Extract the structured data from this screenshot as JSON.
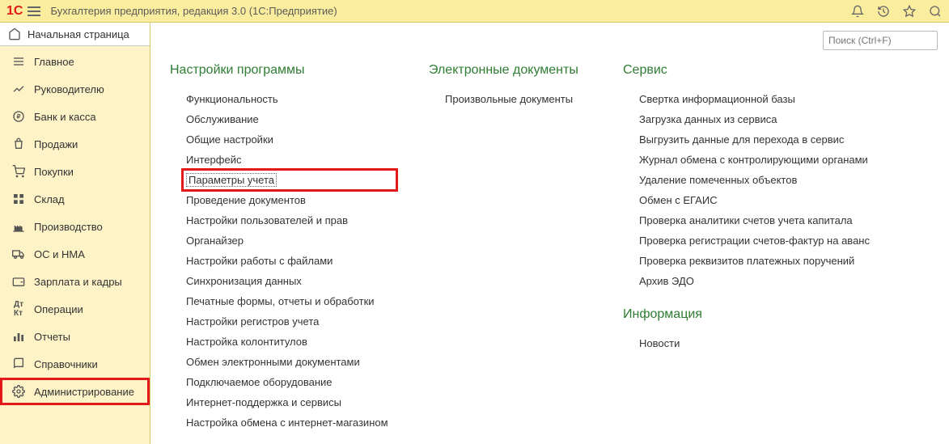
{
  "titlebar": {
    "app_title": "Бухгалтерия предприятия, редакция 3.0   (1С:Предприятие)"
  },
  "sidebar": {
    "home": "Начальная страница",
    "items": [
      "Главное",
      "Руководителю",
      "Банк и касса",
      "Продажи",
      "Покупки",
      "Склад",
      "Производство",
      "ОС и НМА",
      "Зарплата и кадры",
      "Операции",
      "Отчеты",
      "Справочники",
      "Администрирование"
    ]
  },
  "search": {
    "placeholder": "Поиск (Ctrl+F)"
  },
  "columns": {
    "col1": {
      "title": "Настройки программы",
      "items": [
        "Функциональность",
        "Обслуживание",
        "Общие настройки",
        "Интерфейс",
        "Параметры учета",
        "Проведение документов",
        "Настройки пользователей и прав",
        "Органайзер",
        "Настройки работы с файлами",
        "Синхронизация данных",
        "Печатные формы, отчеты и обработки",
        "Настройки регистров учета",
        "Настройка колонтитулов",
        "Обмен электронными документами",
        "Подключаемое оборудование",
        "Интернет-поддержка и сервисы",
        "Настройка обмена с интернет-магазином"
      ]
    },
    "col2": {
      "title": "Электронные документы",
      "items": [
        "Произвольные документы"
      ]
    },
    "col3a": {
      "title": "Сервис",
      "items": [
        "Свертка информационной базы",
        "Загрузка данных из сервиса",
        "Выгрузить данные для перехода в сервис",
        "Журнал обмена с контролирующими органами",
        "Удаление помеченных объектов",
        "Обмен с ЕГАИС",
        "Проверка аналитики счетов учета капитала",
        "Проверка регистрации счетов-фактур на аванс",
        "Проверка реквизитов платежных поручений",
        "Архив ЭДО"
      ]
    },
    "col3b": {
      "title": "Информация",
      "items": [
        "Новости"
      ]
    }
  }
}
